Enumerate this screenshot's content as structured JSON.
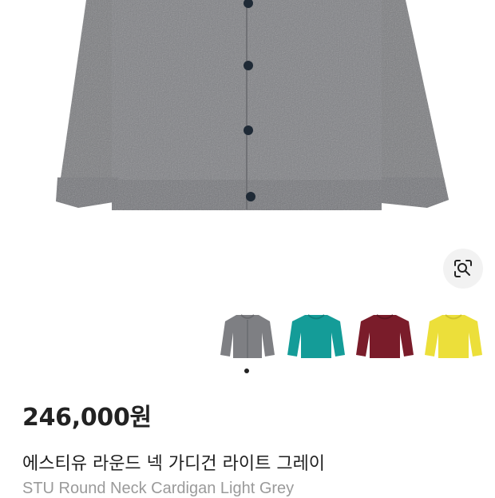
{
  "product": {
    "price": "246,000원",
    "name_ko": "에스티유 라운드 넥 가디건 라이트 그레이",
    "name_en": "STU Round Neck Cardigan Light Grey"
  },
  "colors": {
    "selected": "grey",
    "options": [
      {
        "name": "grey",
        "hex": "#7e7f83"
      },
      {
        "name": "teal",
        "hex": "#149c98"
      },
      {
        "name": "burgundy",
        "hex": "#7a1c2a"
      },
      {
        "name": "yellow",
        "hex": "#ecdf3a"
      }
    ]
  },
  "icons": {
    "lens": "lens-search-icon"
  }
}
